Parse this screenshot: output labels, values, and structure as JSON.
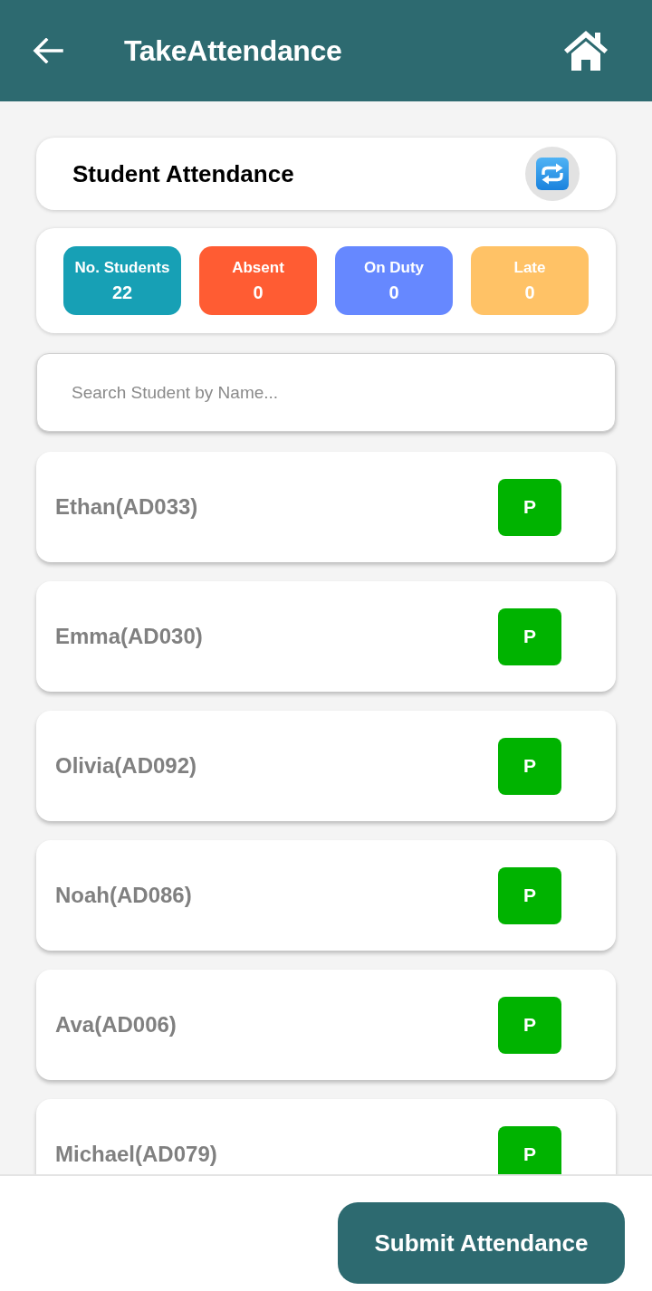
{
  "header": {
    "title": "TakeAttendance"
  },
  "attendance_card": {
    "title": "Student Attendance"
  },
  "stats": [
    {
      "label": "No. Students",
      "value": "22",
      "color": "#17a0b5"
    },
    {
      "label": "Absent",
      "value": "0",
      "color": "#ff5c33"
    },
    {
      "label": "On Duty",
      "value": "0",
      "color": "#6688ff"
    },
    {
      "label": "Late",
      "value": "0",
      "color": "#ffc266"
    }
  ],
  "search": {
    "placeholder": "Search Student by Name..."
  },
  "students": [
    {
      "name": "Ethan(AD033)",
      "status": "P"
    },
    {
      "name": "Emma(AD030)",
      "status": "P"
    },
    {
      "name": "Olivia(AD092)",
      "status": "P"
    },
    {
      "name": "Noah(AD086)",
      "status": "P"
    },
    {
      "name": "Ava(AD006)",
      "status": "P"
    },
    {
      "name": "Michael(AD079)",
      "status": "P"
    }
  ],
  "submit_button": "Submit Attendance"
}
